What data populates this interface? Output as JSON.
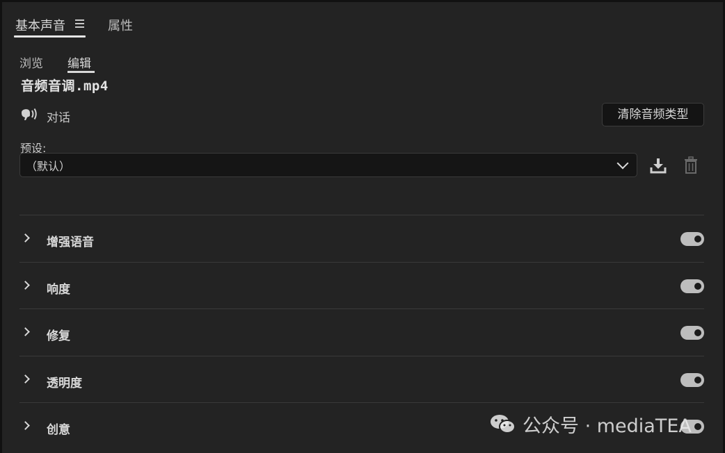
{
  "header": {
    "tab_essential": "基本声音",
    "tab_properties": "属性"
  },
  "subtabs": {
    "browse": "浏览",
    "edit": "编辑"
  },
  "clip": {
    "name": "音频音调.mp4",
    "type_label": "对话",
    "type_icon": "dialogue-icon",
    "clear_button": "清除音频类型"
  },
  "preset": {
    "label": "预设:",
    "value": "（默认）"
  },
  "sections": [
    {
      "label": "增强语音",
      "enabled": true
    },
    {
      "label": "响度",
      "enabled": true
    },
    {
      "label": "修复",
      "enabled": true
    },
    {
      "label": "透明度",
      "enabled": true
    },
    {
      "label": "创意",
      "enabled": true
    }
  ],
  "watermark": {
    "text": "公众号 · mediaTEA"
  },
  "colors": {
    "panel_bg": "#232323",
    "toggle_on": "#bdbdbd",
    "text": "#d8d8d8"
  }
}
